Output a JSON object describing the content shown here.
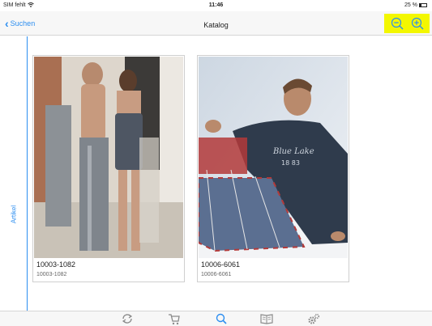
{
  "status_bar": {
    "carrier": "SIM fehlt",
    "time": "11:46",
    "battery": "25 %"
  },
  "nav": {
    "back_label": "Suchen",
    "title": "Katalog"
  },
  "side_rail": {
    "label": "Artikel"
  },
  "products": [
    {
      "title": "10003-1082",
      "subtitle": "10003-1082"
    },
    {
      "title": "10006-6061",
      "subtitle": "10006-6061"
    }
  ],
  "tab_bar": {
    "icons": [
      "sync-icon",
      "cart-icon",
      "search-icon",
      "catalog-book-icon",
      "settings-gears-icon"
    ],
    "active_index": 2
  },
  "colors": {
    "accent": "#2c8ef0",
    "highlight": "#f3f700"
  }
}
